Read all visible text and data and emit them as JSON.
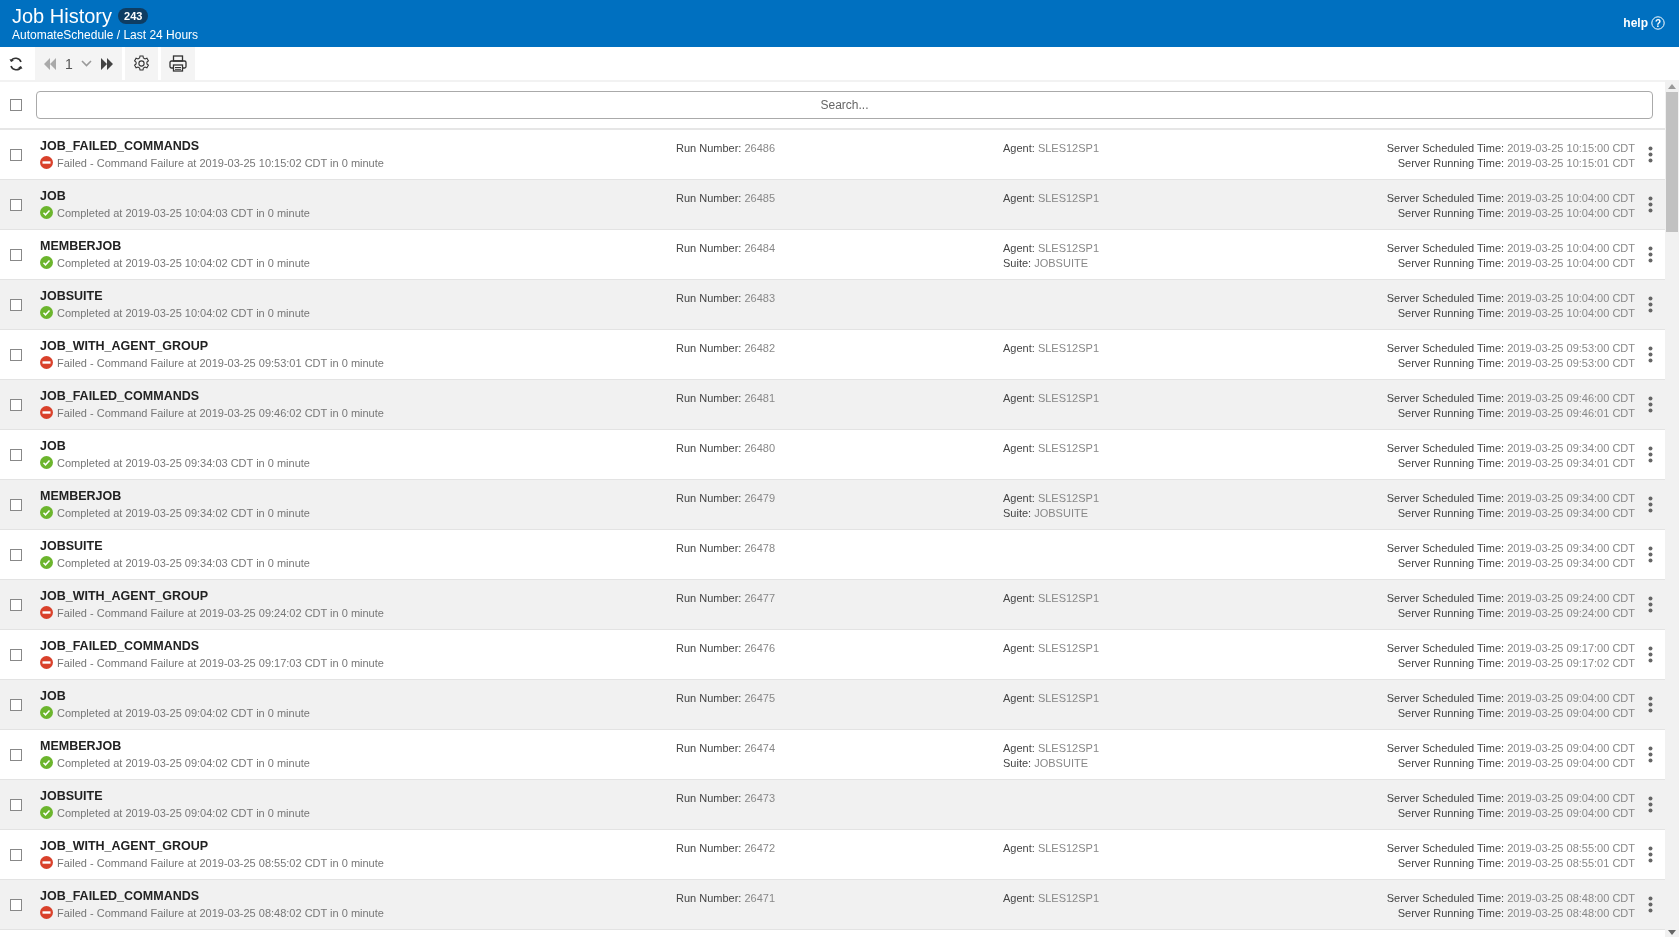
{
  "header": {
    "title": "Job History",
    "count": "243",
    "subtitle": "AutomateSchedule / Last 24 Hours",
    "help": "help",
    "help_icon": "?"
  },
  "toolbar": {
    "page": "1",
    "back": {
      "disabled": true
    },
    "forward": {
      "disabled": false
    }
  },
  "search": {
    "placeholder": "Search...",
    "checked": false
  },
  "rows": [
    {
      "name": "JOB_FAILED_COMMANDS",
      "kind": "failed",
      "message": "Failed - Command Failure at 2019-03-25 10:15:02 CDT in 0 minute",
      "checked": false,
      "run": {
        "label": "Run Number:",
        "value": "26486"
      },
      "fields": [
        {
          "label": "Agent:",
          "value": "SLES12SP1"
        }
      ],
      "times": [
        {
          "label": "Server Scheduled Time:",
          "value": "2019-03-25 10:15:00 CDT"
        },
        {
          "label": "Server Running Time:",
          "value": "2019-03-25 10:15:01 CDT"
        }
      ]
    },
    {
      "name": "JOB",
      "kind": "completed",
      "message": "Completed at 2019-03-25 10:04:03 CDT in 0 minute",
      "checked": false,
      "run": {
        "label": "Run Number:",
        "value": "26485"
      },
      "fields": [
        {
          "label": "Agent:",
          "value": "SLES12SP1"
        }
      ],
      "times": [
        {
          "label": "Server Scheduled Time:",
          "value": "2019-03-25 10:04:00 CDT"
        },
        {
          "label": "Server Running Time:",
          "value": "2019-03-25 10:04:00 CDT"
        }
      ]
    },
    {
      "name": "MEMBERJOB",
      "kind": "completed",
      "message": "Completed at 2019-03-25 10:04:02 CDT in 0 minute",
      "checked": false,
      "run": {
        "label": "Run Number:",
        "value": "26484"
      },
      "fields": [
        {
          "label": "Agent:",
          "value": "SLES12SP1"
        },
        {
          "label": "Suite:",
          "value": "JOBSUITE"
        }
      ],
      "times": [
        {
          "label": "Server Scheduled Time:",
          "value": "2019-03-25 10:04:00 CDT"
        },
        {
          "label": "Server Running Time:",
          "value": "2019-03-25 10:04:00 CDT"
        }
      ]
    },
    {
      "name": "JOBSUITE",
      "kind": "completed",
      "message": "Completed at 2019-03-25 10:04:02 CDT in 0 minute",
      "checked": false,
      "run": {
        "label": "Run Number:",
        "value": "26483"
      },
      "fields": [],
      "times": [
        {
          "label": "Server Scheduled Time:",
          "value": "2019-03-25 10:04:00 CDT"
        },
        {
          "label": "Server Running Time:",
          "value": "2019-03-25 10:04:00 CDT"
        }
      ]
    },
    {
      "name": "JOB_WITH_AGENT_GROUP",
      "kind": "failed",
      "message": "Failed - Command Failure at 2019-03-25 09:53:01 CDT in 0 minute",
      "checked": false,
      "run": {
        "label": "Run Number:",
        "value": "26482"
      },
      "fields": [
        {
          "label": "Agent:",
          "value": "SLES12SP1"
        }
      ],
      "times": [
        {
          "label": "Server Scheduled Time:",
          "value": "2019-03-25 09:53:00 CDT"
        },
        {
          "label": "Server Running Time:",
          "value": "2019-03-25 09:53:00 CDT"
        }
      ]
    },
    {
      "name": "JOB_FAILED_COMMANDS",
      "kind": "failed",
      "message": "Failed - Command Failure at 2019-03-25 09:46:02 CDT in 0 minute",
      "checked": false,
      "run": {
        "label": "Run Number:",
        "value": "26481"
      },
      "fields": [
        {
          "label": "Agent:",
          "value": "SLES12SP1"
        }
      ],
      "times": [
        {
          "label": "Server Scheduled Time:",
          "value": "2019-03-25 09:46:00 CDT"
        },
        {
          "label": "Server Running Time:",
          "value": "2019-03-25 09:46:01 CDT"
        }
      ]
    },
    {
      "name": "JOB",
      "kind": "completed",
      "message": "Completed at 2019-03-25 09:34:03 CDT in 0 minute",
      "checked": false,
      "run": {
        "label": "Run Number:",
        "value": "26480"
      },
      "fields": [
        {
          "label": "Agent:",
          "value": "SLES12SP1"
        }
      ],
      "times": [
        {
          "label": "Server Scheduled Time:",
          "value": "2019-03-25 09:34:00 CDT"
        },
        {
          "label": "Server Running Time:",
          "value": "2019-03-25 09:34:01 CDT"
        }
      ]
    },
    {
      "name": "MEMBERJOB",
      "kind": "completed",
      "message": "Completed at 2019-03-25 09:34:02 CDT in 0 minute",
      "checked": false,
      "run": {
        "label": "Run Number:",
        "value": "26479"
      },
      "fields": [
        {
          "label": "Agent:",
          "value": "SLES12SP1"
        },
        {
          "label": "Suite:",
          "value": "JOBSUITE"
        }
      ],
      "times": [
        {
          "label": "Server Scheduled Time:",
          "value": "2019-03-25 09:34:00 CDT"
        },
        {
          "label": "Server Running Time:",
          "value": "2019-03-25 09:34:00 CDT"
        }
      ]
    },
    {
      "name": "JOBSUITE",
      "kind": "completed",
      "message": "Completed at 2019-03-25 09:34:03 CDT in 0 minute",
      "checked": false,
      "run": {
        "label": "Run Number:",
        "value": "26478"
      },
      "fields": [],
      "times": [
        {
          "label": "Server Scheduled Time:",
          "value": "2019-03-25 09:34:00 CDT"
        },
        {
          "label": "Server Running Time:",
          "value": "2019-03-25 09:34:00 CDT"
        }
      ]
    },
    {
      "name": "JOB_WITH_AGENT_GROUP",
      "kind": "failed",
      "message": "Failed - Command Failure at 2019-03-25 09:24:02 CDT in 0 minute",
      "checked": false,
      "run": {
        "label": "Run Number:",
        "value": "26477"
      },
      "fields": [
        {
          "label": "Agent:",
          "value": "SLES12SP1"
        }
      ],
      "times": [
        {
          "label": "Server Scheduled Time:",
          "value": "2019-03-25 09:24:00 CDT"
        },
        {
          "label": "Server Running Time:",
          "value": "2019-03-25 09:24:00 CDT"
        }
      ]
    },
    {
      "name": "JOB_FAILED_COMMANDS",
      "kind": "failed",
      "message": "Failed - Command Failure at 2019-03-25 09:17:03 CDT in 0 minute",
      "checked": false,
      "run": {
        "label": "Run Number:",
        "value": "26476"
      },
      "fields": [
        {
          "label": "Agent:",
          "value": "SLES12SP1"
        }
      ],
      "times": [
        {
          "label": "Server Scheduled Time:",
          "value": "2019-03-25 09:17:00 CDT"
        },
        {
          "label": "Server Running Time:",
          "value": "2019-03-25 09:17:02 CDT"
        }
      ]
    },
    {
      "name": "JOB",
      "kind": "completed",
      "message": "Completed at 2019-03-25 09:04:02 CDT in 0 minute",
      "checked": false,
      "run": {
        "label": "Run Number:",
        "value": "26475"
      },
      "fields": [
        {
          "label": "Agent:",
          "value": "SLES12SP1"
        }
      ],
      "times": [
        {
          "label": "Server Scheduled Time:",
          "value": "2019-03-25 09:04:00 CDT"
        },
        {
          "label": "Server Running Time:",
          "value": "2019-03-25 09:04:00 CDT"
        }
      ]
    },
    {
      "name": "MEMBERJOB",
      "kind": "completed",
      "message": "Completed at 2019-03-25 09:04:02 CDT in 0 minute",
      "checked": false,
      "run": {
        "label": "Run Number:",
        "value": "26474"
      },
      "fields": [
        {
          "label": "Agent:",
          "value": "SLES12SP1"
        },
        {
          "label": "Suite:",
          "value": "JOBSUITE"
        }
      ],
      "times": [
        {
          "label": "Server Scheduled Time:",
          "value": "2019-03-25 09:04:00 CDT"
        },
        {
          "label": "Server Running Time:",
          "value": "2019-03-25 09:04:00 CDT"
        }
      ]
    },
    {
      "name": "JOBSUITE",
      "kind": "completed",
      "message": "Completed at 2019-03-25 09:04:02 CDT in 0 minute",
      "checked": false,
      "run": {
        "label": "Run Number:",
        "value": "26473"
      },
      "fields": [],
      "times": [
        {
          "label": "Server Scheduled Time:",
          "value": "2019-03-25 09:04:00 CDT"
        },
        {
          "label": "Server Running Time:",
          "value": "2019-03-25 09:04:00 CDT"
        }
      ]
    },
    {
      "name": "JOB_WITH_AGENT_GROUP",
      "kind": "failed",
      "message": "Failed - Command Failure at 2019-03-25 08:55:02 CDT in 0 minute",
      "checked": false,
      "run": {
        "label": "Run Number:",
        "value": "26472"
      },
      "fields": [
        {
          "label": "Agent:",
          "value": "SLES12SP1"
        }
      ],
      "times": [
        {
          "label": "Server Scheduled Time:",
          "value": "2019-03-25 08:55:00 CDT"
        },
        {
          "label": "Server Running Time:",
          "value": "2019-03-25 08:55:01 CDT"
        }
      ]
    },
    {
      "name": "JOB_FAILED_COMMANDS",
      "kind": "failed",
      "message": "Failed - Command Failure at 2019-03-25 08:48:02 CDT in 0 minute",
      "checked": false,
      "run": {
        "label": "Run Number:",
        "value": "26471"
      },
      "fields": [
        {
          "label": "Agent:",
          "value": "SLES12SP1"
        }
      ],
      "times": [
        {
          "label": "Server Scheduled Time:",
          "value": "2019-03-25 08:48:00 CDT"
        },
        {
          "label": "Server Running Time:",
          "value": "2019-03-25 08:48:00 CDT"
        }
      ]
    }
  ]
}
